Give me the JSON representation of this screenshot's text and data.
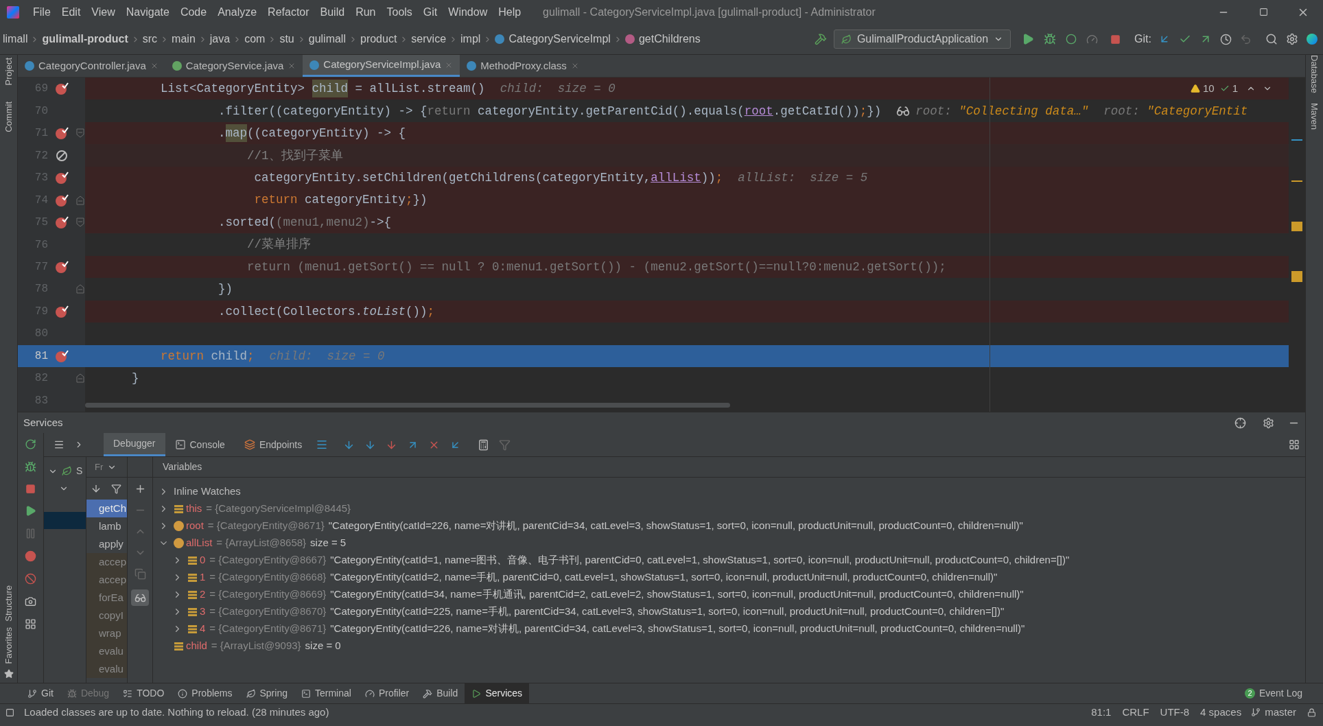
{
  "window": {
    "title": "gulimall - CategoryServiceImpl.java [gulimall-product] - Administrator"
  },
  "menu": [
    "File",
    "Edit",
    "View",
    "Navigate",
    "Code",
    "Analyze",
    "Refactor",
    "Build",
    "Run",
    "Tools",
    "Git",
    "Window",
    "Help"
  ],
  "breadcrumb": [
    {
      "label": "limall",
      "kind": "folder"
    },
    {
      "label": "gulimall-product",
      "kind": "module"
    },
    {
      "label": "src",
      "kind": "folder"
    },
    {
      "label": "main",
      "kind": "folder"
    },
    {
      "label": "java",
      "kind": "folder"
    },
    {
      "label": "com",
      "kind": "folder"
    },
    {
      "label": "stu",
      "kind": "folder"
    },
    {
      "label": "gulimall",
      "kind": "folder"
    },
    {
      "label": "product",
      "kind": "folder"
    },
    {
      "label": "service",
      "kind": "folder"
    },
    {
      "label": "impl",
      "kind": "folder"
    },
    {
      "label": "CategoryServiceImpl",
      "kind": "class"
    },
    {
      "label": "getChildrens",
      "kind": "method"
    }
  ],
  "run_config": "GulimallProductApplication",
  "git_label": "Git:",
  "left_tools_top": [
    "Project",
    "Commit"
  ],
  "left_tools_bottom": [
    "Structure",
    "Favorites"
  ],
  "right_tools": [
    "Database",
    "Maven"
  ],
  "editor_tabs": [
    {
      "label": "CategoryController.java",
      "kind": "class",
      "selected": false
    },
    {
      "label": "CategoryService.java",
      "kind": "interface",
      "selected": false
    },
    {
      "label": "CategoryServiceImpl.java",
      "kind": "class",
      "selected": true
    },
    {
      "label": "MethodProxy.class",
      "kind": "class",
      "selected": false
    }
  ],
  "inspections": {
    "warnings": "10",
    "passed": "1"
  },
  "code_lines": [
    {
      "number": "69",
      "breakpoint": true,
      "muted": false,
      "current": false,
      "fold_start": false,
      "fold_end": false,
      "tokens": [
        {
          "kind": "plain",
          "text": "        List<CategoryEntity> "
        },
        {
          "kind": "usage",
          "text": "child"
        },
        {
          "kind": "plain",
          "text": " = allList.stream()"
        },
        {
          "kind": "hint",
          "text": "child:  size = 0"
        }
      ]
    },
    {
      "number": "70",
      "breakpoint": false,
      "muted": false,
      "current": false,
      "fold_start": false,
      "fold_end": false,
      "tokens": [
        {
          "kind": "plain",
          "text": "                .filter((categoryEntity) -> {"
        },
        {
          "kind": "dim",
          "text": "return"
        },
        {
          "kind": "plain",
          "text": " categoryEntity.getParentCid().equals("
        },
        {
          "kind": "field",
          "text": "root"
        },
        {
          "kind": "plain",
          "text": ".getCatId())"
        },
        {
          "kind": "keyword",
          "text": ";"
        },
        {
          "kind": "plain",
          "text": "})"
        },
        {
          "kind": "watch"
        },
        {
          "kind": "hint",
          "text": "root: "
        },
        {
          "kind": "hint_string",
          "text": "\"Collecting data…\""
        },
        {
          "kind": "hint",
          "text": "root: "
        },
        {
          "kind": "hint_string",
          "text": "\"CategoryEntit"
        }
      ]
    },
    {
      "number": "71",
      "breakpoint": true,
      "muted": false,
      "current": false,
      "fold_start": true,
      "fold_end": false,
      "tokens": [
        {
          "kind": "plain",
          "text": "                ."
        },
        {
          "kind": "usage",
          "text": "map"
        },
        {
          "kind": "plain",
          "text": "((categoryEntity) -> {"
        }
      ]
    },
    {
      "number": "72",
      "breakpoint": true,
      "muted": true,
      "current": false,
      "fold_start": false,
      "fold_end": false,
      "tokens": [
        {
          "kind": "comment",
          "text": "                    //1、找到子菜单"
        }
      ]
    },
    {
      "number": "73",
      "breakpoint": true,
      "muted": false,
      "current": false,
      "fold_start": false,
      "fold_end": false,
      "tokens": [
        {
          "kind": "plain",
          "text": "                     categoryEntity.setChildren(getChildrens(categoryEntity,"
        },
        {
          "kind": "field",
          "text": "allList"
        },
        {
          "kind": "plain",
          "text": "))"
        },
        {
          "kind": "keyword",
          "text": ";"
        },
        {
          "kind": "hint",
          "text": "allList:  size = 5"
        }
      ]
    },
    {
      "number": "74",
      "breakpoint": true,
      "muted": false,
      "current": false,
      "fold_start": false,
      "fold_end": true,
      "tokens": [
        {
          "kind": "keyword",
          "text": "                     return"
        },
        {
          "kind": "plain",
          "text": " categoryEntity"
        },
        {
          "kind": "keyword",
          "text": ";"
        },
        {
          "kind": "plain",
          "text": "})"
        }
      ]
    },
    {
      "number": "75",
      "breakpoint": true,
      "muted": false,
      "current": false,
      "fold_start": true,
      "fold_end": false,
      "tokens": [
        {
          "kind": "plain",
          "text": "                .sorted("
        },
        {
          "kind": "dim",
          "text": "(menu1,menu2)"
        },
        {
          "kind": "plain",
          "text": "->{"
        }
      ]
    },
    {
      "number": "76",
      "breakpoint": false,
      "muted": false,
      "current": false,
      "fold_start": false,
      "fold_end": false,
      "tokens": [
        {
          "kind": "comment",
          "text": "                    //菜单排序"
        }
      ]
    },
    {
      "number": "77",
      "breakpoint": true,
      "muted": false,
      "current": false,
      "fold_start": false,
      "fold_end": false,
      "tokens": [
        {
          "kind": "dim",
          "text": "                    return (menu1.getSort() == null ? 0:menu1.getSort()) - (menu2.getSort()==null?0:menu2.getSort());"
        }
      ]
    },
    {
      "number": "78",
      "breakpoint": false,
      "muted": false,
      "current": false,
      "fold_start": false,
      "fold_end": true,
      "tokens": [
        {
          "kind": "plain",
          "text": "                })"
        }
      ]
    },
    {
      "number": "79",
      "breakpoint": true,
      "muted": false,
      "current": false,
      "fold_start": false,
      "fold_end": false,
      "tokens": [
        {
          "kind": "plain",
          "text": "                .collect(Collectors."
        },
        {
          "kind": "italic",
          "text": "toList"
        },
        {
          "kind": "plain",
          "text": "())"
        },
        {
          "kind": "keyword",
          "text": ";"
        }
      ]
    },
    {
      "number": "80",
      "breakpoint": false,
      "muted": false,
      "current": false,
      "fold_start": false,
      "fold_end": false
    },
    {
      "number": "81",
      "breakpoint": true,
      "muted": false,
      "current": true,
      "fold_start": false,
      "fold_end": false,
      "tokens": [
        {
          "kind": "keyword",
          "text": "        return"
        },
        {
          "kind": "plain",
          "text": " child"
        },
        {
          "kind": "keyword",
          "text": ";"
        },
        {
          "kind": "hint",
          "text": "child:  size = 0"
        }
      ]
    },
    {
      "number": "82",
      "breakpoint": false,
      "muted": false,
      "current": false,
      "fold_start": false,
      "fold_end": true,
      "tokens": [
        {
          "kind": "plain",
          "text": "    }"
        }
      ]
    },
    {
      "number": "83",
      "breakpoint": false,
      "muted": false,
      "current": false,
      "fold_start": false,
      "fold_end": false
    }
  ],
  "services": {
    "title": "Services",
    "tree_label": "S",
    "debugger_tabs": [
      {
        "label": "Debugger",
        "kind": "debugger",
        "selected": true
      },
      {
        "label": "Console",
        "kind": "console",
        "selected": false
      },
      {
        "label": "Endpoints",
        "kind": "endpoints",
        "selected": false
      }
    ],
    "frames_header": "Fr",
    "variables_header": "Variables",
    "frames": [
      {
        "label": "getCh",
        "selected": true,
        "library": false
      },
      {
        "label": "lamb",
        "selected": false,
        "library": false
      },
      {
        "label": "apply",
        "selected": false,
        "library": false
      },
      {
        "label": "accep",
        "selected": false,
        "library": true
      },
      {
        "label": "accep",
        "selected": false,
        "library": true
      },
      {
        "label": "forEa",
        "selected": false,
        "library": true
      },
      {
        "label": "copyI",
        "selected": false,
        "library": true
      },
      {
        "label": "wrap",
        "selected": false,
        "library": true
      },
      {
        "label": "evalu",
        "selected": false,
        "library": true
      },
      {
        "label": "evalu",
        "selected": false,
        "library": true
      }
    ],
    "variables": [
      {
        "kind": "watches",
        "name": "Inline Watches",
        "leaf": false,
        "expanded": false
      },
      {
        "kind": "object",
        "name": "this",
        "type": "= {CategoryServiceImpl@8445}",
        "leaf": false,
        "expanded": false
      },
      {
        "kind": "param",
        "name": "root",
        "type": "= {CategoryEntity@8671}",
        "value": "\"CategoryEntity(catId=226, name=对讲机, parentCid=34, catLevel=3, showStatus=1, sort=0, icon=null, productUnit=null, productCount=0, children=null)\"",
        "leaf": false,
        "expanded": false
      },
      {
        "kind": "param",
        "name": "allList",
        "type": "= {ArrayList@8658}",
        "value": "size = 5",
        "leaf": false,
        "expanded": true,
        "children": [
          {
            "kind": "object",
            "name": "0",
            "type": "= {CategoryEntity@8667}",
            "value": "\"CategoryEntity(catId=1, name=图书、音像、电子书刊, parentCid=0, catLevel=1, showStatus=1, sort=0, icon=null, productUnit=null, productCount=0, children=[])\"",
            "leaf": false,
            "expanded": false
          },
          {
            "kind": "object",
            "name": "1",
            "type": "= {CategoryEntity@8668}",
            "value": "\"CategoryEntity(catId=2, name=手机, parentCid=0, catLevel=1, showStatus=1, sort=0, icon=null, productUnit=null, productCount=0, children=null)\"",
            "leaf": false,
            "expanded": false
          },
          {
            "kind": "object",
            "name": "2",
            "type": "= {CategoryEntity@8669}",
            "value": "\"CategoryEntity(catId=34, name=手机通讯, parentCid=2, catLevel=2, showStatus=1, sort=0, icon=null, productUnit=null, productCount=0, children=null)\"",
            "leaf": false,
            "expanded": false
          },
          {
            "kind": "object",
            "name": "3",
            "type": "= {CategoryEntity@8670}",
            "value": "\"CategoryEntity(catId=225, name=手机, parentCid=34, catLevel=3, showStatus=1, sort=0, icon=null, productUnit=null, productCount=0, children=[])\"",
            "leaf": false,
            "expanded": false
          },
          {
            "kind": "object",
            "name": "4",
            "type": "= {CategoryEntity@8671}",
            "value": "\"CategoryEntity(catId=226, name=对讲机, parentCid=34, catLevel=3, showStatus=1, sort=0, icon=null, productUnit=null, productCount=0, children=null)\"",
            "leaf": false,
            "expanded": false
          }
        ]
      },
      {
        "kind": "object",
        "name": "child",
        "type": "= {ArrayList@9093}",
        "value": "size = 0",
        "leaf": true
      }
    ]
  },
  "tool_tabs": [
    {
      "label": "Git",
      "kind": "git",
      "selected": false,
      "disabled": false
    },
    {
      "label": "Debug",
      "kind": "debug",
      "selected": false,
      "disabled": true
    },
    {
      "label": "TODO",
      "kind": "todo",
      "selected": false,
      "disabled": false
    },
    {
      "label": "Problems",
      "kind": "problems",
      "selected": false,
      "disabled": false
    },
    {
      "label": "Spring",
      "kind": "spring",
      "selected": false,
      "disabled": false
    },
    {
      "label": "Terminal",
      "kind": "terminal",
      "selected": false,
      "disabled": false
    },
    {
      "label": "Profiler",
      "kind": "profiler",
      "selected": false,
      "disabled": false
    },
    {
      "label": "Build",
      "kind": "build",
      "selected": false,
      "disabled": false
    },
    {
      "label": "Services",
      "kind": "services",
      "selected": true,
      "disabled": false
    }
  ],
  "event_log": {
    "label": "Event Log",
    "count": "2"
  },
  "status_bar": {
    "message": "Loaded classes are up to date. Nothing to reload. (28 minutes ago)",
    "position": "81:1",
    "line_separator": "CRLF",
    "encoding": "UTF-8",
    "indent": "4 spaces",
    "branch": "master"
  }
}
